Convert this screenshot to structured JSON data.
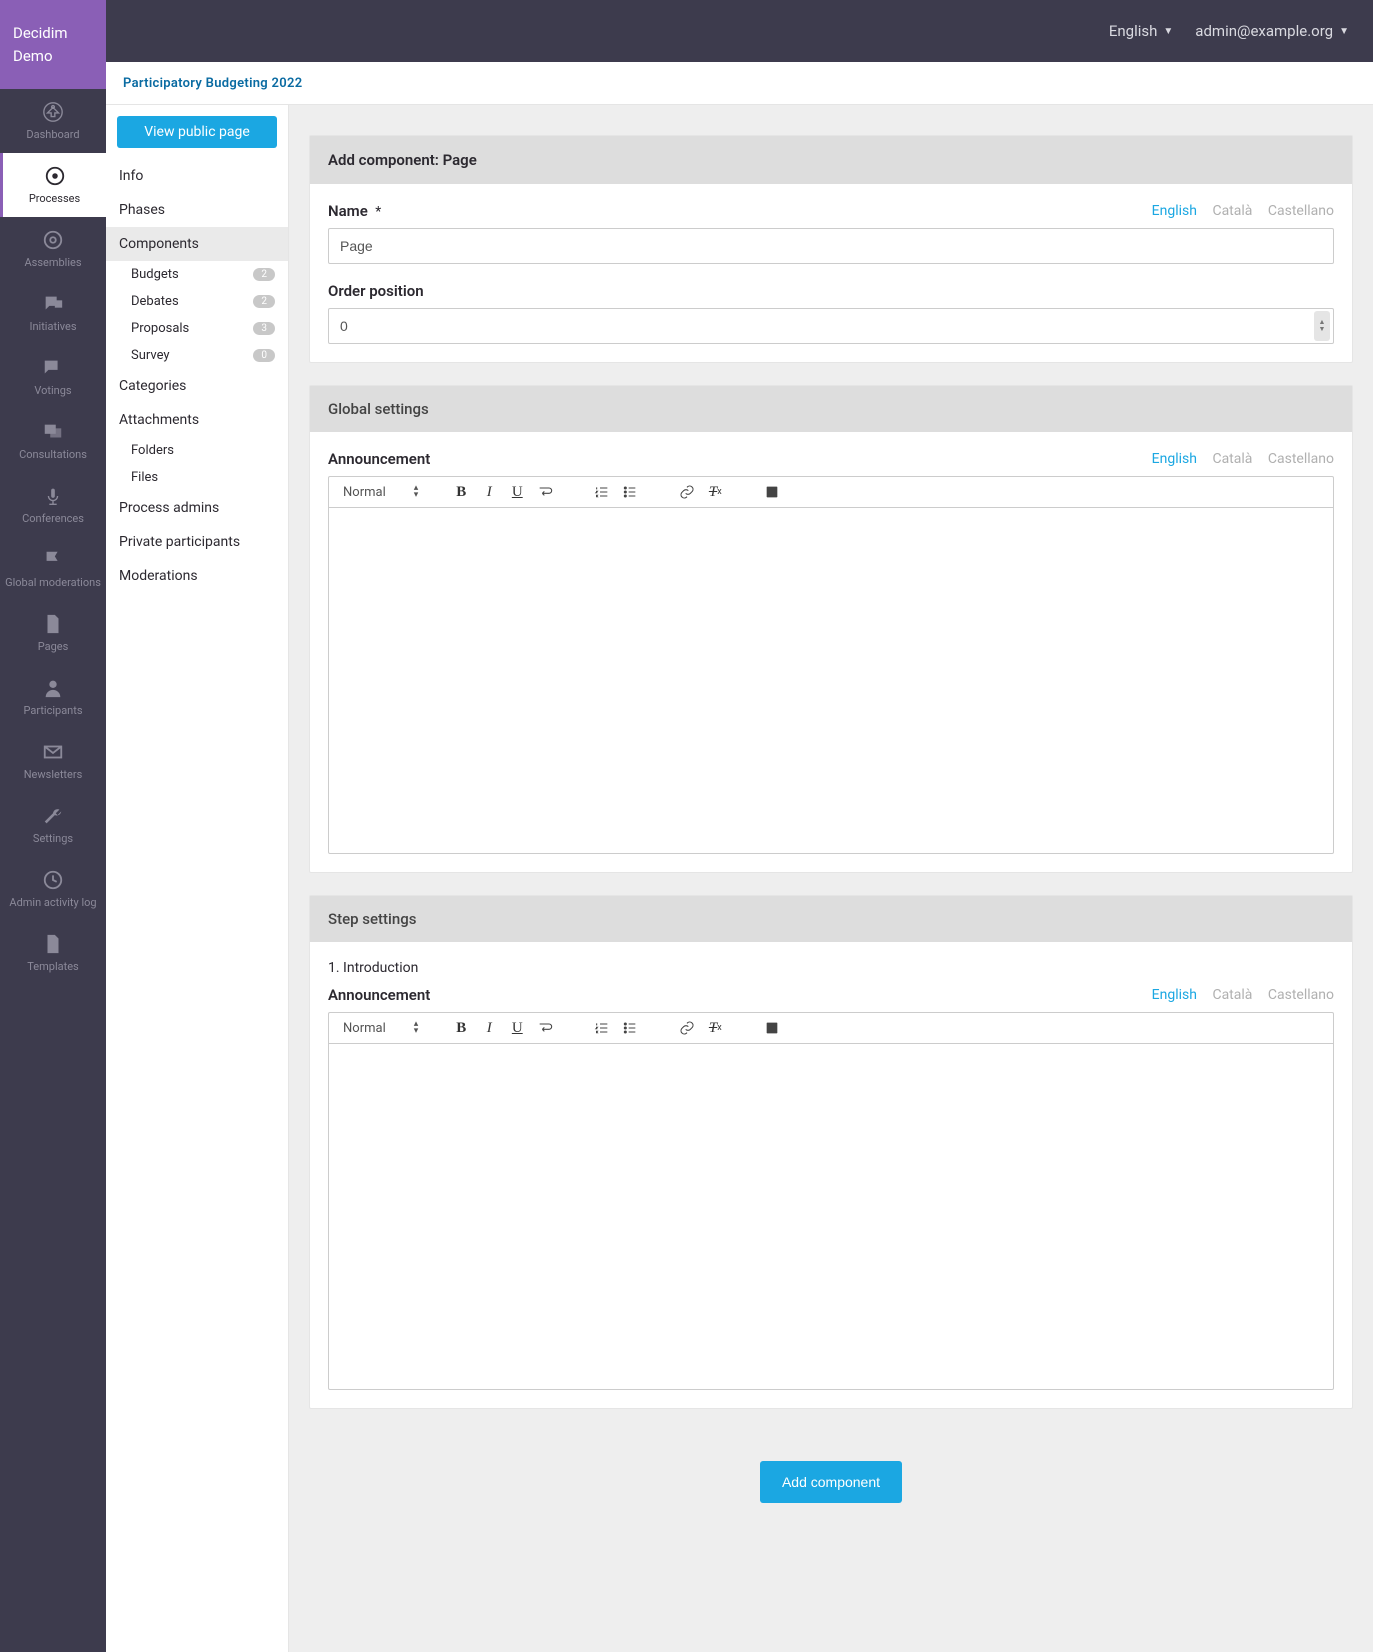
{
  "brand": "Decidim Demo",
  "topbar": {
    "language": "English",
    "email": "admin@example.org"
  },
  "breadcrumb": "Participatory Budgeting 2022",
  "mainnav": [
    {
      "id": "dashboard",
      "label": "Dashboard"
    },
    {
      "id": "processes",
      "label": "Processes"
    },
    {
      "id": "assemblies",
      "label": "Assemblies"
    },
    {
      "id": "initiatives",
      "label": "Initiatives"
    },
    {
      "id": "votings",
      "label": "Votings"
    },
    {
      "id": "consultations",
      "label": "Consultations"
    },
    {
      "id": "conferences",
      "label": "Conferences"
    },
    {
      "id": "global-moderations",
      "label": "Global moderations"
    },
    {
      "id": "pages",
      "label": "Pages"
    },
    {
      "id": "participants",
      "label": "Participants"
    },
    {
      "id": "newsletters",
      "label": "Newsletters"
    },
    {
      "id": "settings",
      "label": "Settings"
    },
    {
      "id": "admin-log",
      "label": "Admin activity log"
    },
    {
      "id": "templates",
      "label": "Templates"
    }
  ],
  "subsidebar": {
    "view_public": "View public page",
    "items": {
      "info": "Info",
      "phases": "Phases",
      "components": "Components",
      "budgets": {
        "label": "Budgets",
        "count": "2"
      },
      "debates": {
        "label": "Debates",
        "count": "2"
      },
      "proposals": {
        "label": "Proposals",
        "count": "3"
      },
      "survey": {
        "label": "Survey",
        "count": "0"
      },
      "categories": "Categories",
      "attachments": "Attachments",
      "folders": "Folders",
      "files": "Files",
      "process_admins": "Process admins",
      "private_participants": "Private participants",
      "moderations": "Moderations"
    }
  },
  "form": {
    "title": "Add component: Page",
    "name_label": "Name",
    "name_value": "Page",
    "order_label": "Order position",
    "order_value": "0",
    "global_settings": "Global settings",
    "step_settings": "Step settings",
    "step_intro": "1. Introduction",
    "announcement": "Announcement",
    "editor_style": "Normal",
    "langs": {
      "en": "English",
      "ca": "Català",
      "es": "Castellano"
    },
    "submit": "Add component"
  }
}
